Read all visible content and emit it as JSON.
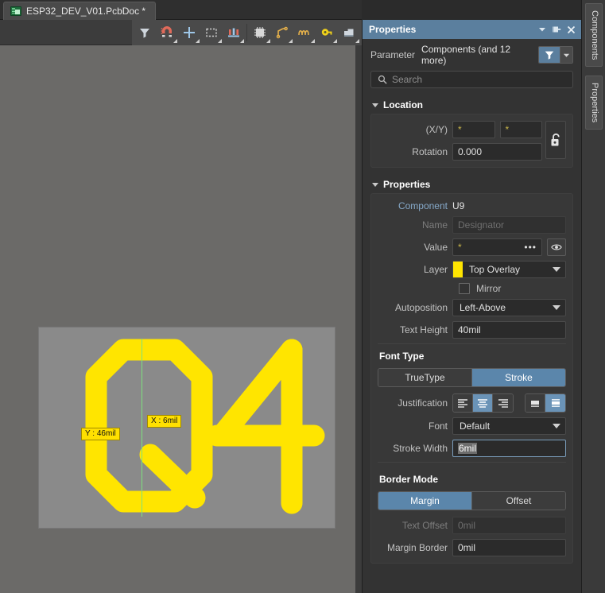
{
  "document_tab": {
    "title": "ESP32_DEV_V01.PcbDoc *",
    "icon": "pcb-document-icon"
  },
  "toolbar": {
    "buttons": [
      {
        "name": "filter-tool",
        "icon": "funnel-icon"
      },
      {
        "name": "magnet-tool",
        "icon": "magnet-icon"
      },
      {
        "name": "crosshair-tool",
        "icon": "crosshair-icon"
      },
      {
        "name": "selection-tool",
        "icon": "dashed-rectangle-icon"
      },
      {
        "name": "place-component",
        "icon": "component-bar-icon"
      },
      {
        "name": "place-ic",
        "icon": "ic-chip-icon"
      },
      {
        "name": "route-tool",
        "icon": "route-track-icon"
      },
      {
        "name": "tune-tool",
        "icon": "squiggle-icon"
      },
      {
        "name": "via-tool",
        "icon": "via-key-icon"
      },
      {
        "name": "polygon-tool",
        "icon": "polygon-pour-icon"
      }
    ]
  },
  "canvas": {
    "board_text": "Q4",
    "tooltip_x": "X : 6mil",
    "tooltip_y": "Y : 46mil",
    "stroke_color": "#ffe500",
    "board_color": "#8a8a8a",
    "background_color": "#6b6a68",
    "centerline_color": "#7de07d"
  },
  "panel": {
    "title": "Properties",
    "title_buttons": [
      {
        "name": "panel-menu-button",
        "icon": "chevron-down-icon"
      },
      {
        "name": "panel-pin-button",
        "icon": "pin-icon"
      },
      {
        "name": "panel-close-button",
        "icon": "close-icon"
      }
    ],
    "parameter": {
      "label": "Parameter",
      "value": "Components (and 12 more)",
      "filter_icon": "funnel-icon",
      "dropdown_icon": "chevron-down-icon"
    },
    "search": {
      "placeholder": "Search",
      "value": "",
      "icon": "search-icon"
    },
    "sections": {
      "location": {
        "title": "Location",
        "xy_label": "(X/Y)",
        "x_value": "*",
        "y_value": "*",
        "rotation_label": "Rotation",
        "rotation_value": "0.000",
        "lock_icon": "unlocked-padlock-icon"
      },
      "properties": {
        "title": "Properties",
        "component_label": "Component",
        "component_value": "U9",
        "name_label": "Name",
        "name_placeholder": "Designator",
        "name_value": "",
        "value_label": "Value",
        "value_value": "*",
        "value_ellipsis": "•••",
        "visibility_icon": "eye-icon",
        "layer_label": "Layer",
        "layer_value": "Top Overlay",
        "layer_swatch_color": "#ffe500",
        "mirror_label": "Mirror",
        "mirror_checked": false,
        "autoposition_label": "Autoposition",
        "autoposition_value": "Left-Above",
        "text_height_label": "Text Height",
        "text_height_value": "40mil"
      },
      "font_type": {
        "title": "Font Type",
        "modes": [
          {
            "label": "TrueType",
            "active": false
          },
          {
            "label": "Stroke",
            "active": true
          }
        ],
        "justification_label": "Justification",
        "justification_horizontal": [
          {
            "name": "justify-left",
            "active": false
          },
          {
            "name": "justify-center",
            "active": true
          },
          {
            "name": "justify-right",
            "active": false
          }
        ],
        "justification_vertical": [
          {
            "name": "align-bottom",
            "active": false
          },
          {
            "name": "align-middle",
            "active": true
          }
        ],
        "font_label": "Font",
        "font_value": "Default",
        "stroke_width_label": "Stroke Width",
        "stroke_width_value": "6mil",
        "stroke_width_selected": true
      },
      "border_mode": {
        "title": "Border Mode",
        "modes": [
          {
            "label": "Margin",
            "active": true
          },
          {
            "label": "Offset",
            "active": false
          }
        ],
        "text_offset_label": "Text Offset",
        "text_offset_value": "0mil",
        "text_offset_disabled": true,
        "margin_border_label": "Margin Border",
        "margin_border_value": "0mil"
      }
    }
  },
  "rail": {
    "tabs": [
      {
        "label": "Components",
        "name": "rail-tab-components"
      },
      {
        "label": "Properties",
        "name": "rail-tab-properties"
      }
    ]
  },
  "colors": {
    "accent": "#5b7f9e",
    "active_blue": "#5b86ab",
    "panel_bg": "#333333",
    "group_bg": "#383838"
  }
}
